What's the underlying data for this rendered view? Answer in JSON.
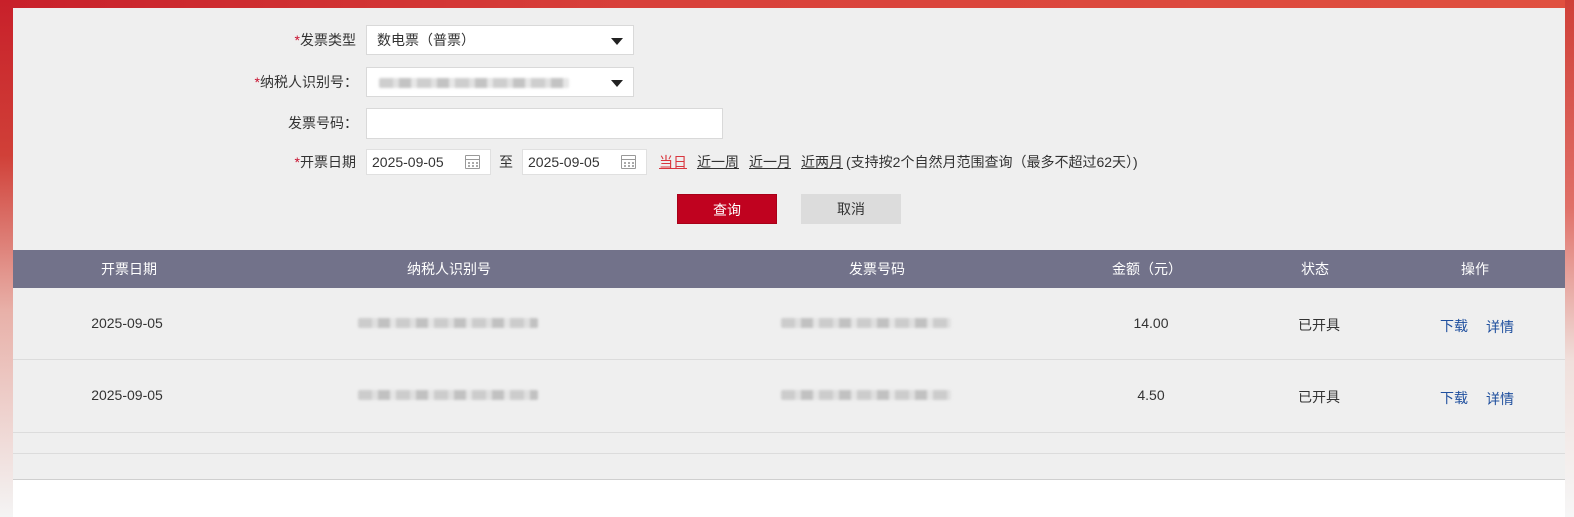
{
  "form": {
    "invoice_type_label": "发票类型",
    "invoice_type_value": "数电票（普票）",
    "taxpayer_id_label": "纳税人识别号：",
    "invoice_number_label": "发票号码：",
    "issue_date_label": "开票日期",
    "required_mark": "*",
    "date_from": "2025-09-05",
    "date_to_separator": "至",
    "date_to": "2025-09-05",
    "quick_ranges": [
      "当日",
      "近一周",
      "近一月",
      "近两月"
    ],
    "active_quick_range": "当日",
    "range_hint": "(支持按2个自然月范围查询（最多不超过62天）)",
    "query_button": "查询",
    "cancel_button": "取消"
  },
  "table": {
    "headers": [
      "开票日期",
      "纳税人识别号",
      "发票号码",
      "金额（元）",
      "状态",
      "操作"
    ],
    "rows": [
      {
        "date": "2025-09-05",
        "amount": "14.00",
        "status": "已开具",
        "download": "下载",
        "details": "详情"
      },
      {
        "date": "2025-09-05",
        "amount": "4.50",
        "status": "已开具",
        "download": "下载",
        "details": "详情"
      }
    ]
  },
  "colors": {
    "accent_red": "#c0021f",
    "header_bg": "#72728a",
    "link_blue": "#1f4f9e",
    "panel_bg": "#efefef"
  }
}
